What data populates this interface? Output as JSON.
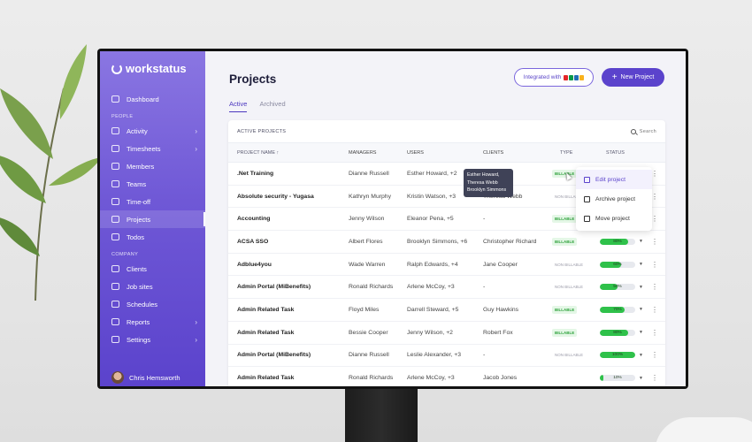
{
  "app": {
    "logo_text": "workstatus"
  },
  "sidebar": {
    "items": [
      {
        "label": "Dashboard",
        "icon": "dashboard-icon"
      },
      {
        "section": "PEOPLE"
      },
      {
        "label": "Activity",
        "icon": "activity-icon",
        "chevron": true
      },
      {
        "label": "Timesheets",
        "icon": "clock-icon",
        "chevron": true
      },
      {
        "label": "Members",
        "icon": "members-icon"
      },
      {
        "label": "Teams",
        "icon": "teams-icon"
      },
      {
        "label": "Time-off",
        "icon": "time-off-icon"
      },
      {
        "label": "Projects",
        "icon": "projects-icon",
        "active": true
      },
      {
        "label": "Todos",
        "icon": "todos-icon"
      },
      {
        "section": "COMPANY"
      },
      {
        "label": "Clients",
        "icon": "clients-icon"
      },
      {
        "label": "Job sites",
        "icon": "job-sites-icon"
      },
      {
        "label": "Schedules",
        "icon": "calendar-icon"
      },
      {
        "label": "Reports",
        "icon": "reports-icon",
        "chevron": true
      },
      {
        "label": "Settings",
        "icon": "gear-icon",
        "chevron": true
      }
    ],
    "user_name": "Chris Hemsworth"
  },
  "header": {
    "title": "Projects",
    "integrated_label": "Integrated with",
    "new_project_label": "New Project"
  },
  "tabs": [
    {
      "label": "Active",
      "active": true
    },
    {
      "label": "Archived",
      "active": false
    }
  ],
  "table": {
    "heading": "ACTIVE PROJECTS",
    "search_label": "Search",
    "columns": [
      "PROJECT NAME ↑",
      "MANAGERS",
      "USERS",
      "CLIENTS",
      "TYPE",
      "STATUS"
    ],
    "rows": [
      {
        "name": ".Net Training",
        "manager": "Dianne Russell",
        "users": "Esther Howard, +2",
        "client": "",
        "type": "BILLABLE",
        "billable": true,
        "progress": null
      },
      {
        "name": "Absolute security - Yugasa",
        "manager": "Kathryn Murphy",
        "users": "Kristin Watson, +3",
        "client": "Theresa Webb",
        "type": "NON BILLABLE",
        "billable": false,
        "progress": null
      },
      {
        "name": "Accounting",
        "manager": "Jenny Wilson",
        "users": "Eleanor Pena, +5",
        "client": "-",
        "type": "BILLABLE",
        "billable": true,
        "progress": null
      },
      {
        "name": "ACSA SSO",
        "manager": "Albert Flores",
        "users": "Brooklyn Simmons, +6",
        "client": "Christopher Richard",
        "type": "BILLABLE",
        "billable": true,
        "progress": 80,
        "progress_label": "80%"
      },
      {
        "name": "Adblue4you",
        "manager": "Wade Warren",
        "users": "Ralph Edwards, +4",
        "client": "Jane Cooper",
        "type": "NON BILLABLE",
        "billable": false,
        "progress": 60,
        "progress_label": "60%"
      },
      {
        "name": "Admin Portal (MiBenefits)",
        "manager": "Ronald Richards",
        "users": "Arlene McCoy, +3",
        "client": "-",
        "type": "NON BILLABLE",
        "billable": false,
        "progress": 50,
        "progress_label": "50%"
      },
      {
        "name": "Admin Related Task",
        "manager": "Floyd Miles",
        "users": "Darrell Steward, +5",
        "client": "Guy Hawkins",
        "type": "BILLABLE",
        "billable": true,
        "progress": 70,
        "progress_label": "70%"
      },
      {
        "name": "Admin Related Task",
        "manager": "Bessie Cooper",
        "users": "Jenny Wilson, +2",
        "client": "Robert Fox",
        "type": "BILLABLE",
        "billable": true,
        "progress": 80,
        "progress_label": "80%"
      },
      {
        "name": "Admin Portal (MiBenefits)",
        "manager": "Dianne Russell",
        "users": "Leslie Alexander, +3",
        "client": "-",
        "type": "NON BILLABLE",
        "billable": false,
        "progress": 100,
        "progress_label": "100%"
      },
      {
        "name": "Admin Related Task",
        "manager": "Ronald Richards",
        "users": "Arlene McCoy, +3",
        "client": "Jacob Jones",
        "type": "",
        "billable": true,
        "progress": 10,
        "progress_label": "10%"
      }
    ]
  },
  "tooltip": {
    "lines": [
      "Esther Howard,",
      "Theresa Webb",
      "Brooklyn Simmons"
    ]
  },
  "dropdown": {
    "items": [
      {
        "label": "Edit project",
        "icon": "edit-icon",
        "active": true
      },
      {
        "label": "Archive project",
        "icon": "archive-icon"
      },
      {
        "label": "Move project",
        "icon": "move-icon"
      }
    ]
  },
  "colors": {
    "accent": "#5b43cc",
    "progress": "#2fc14a",
    "billable": "#2fa23c"
  }
}
